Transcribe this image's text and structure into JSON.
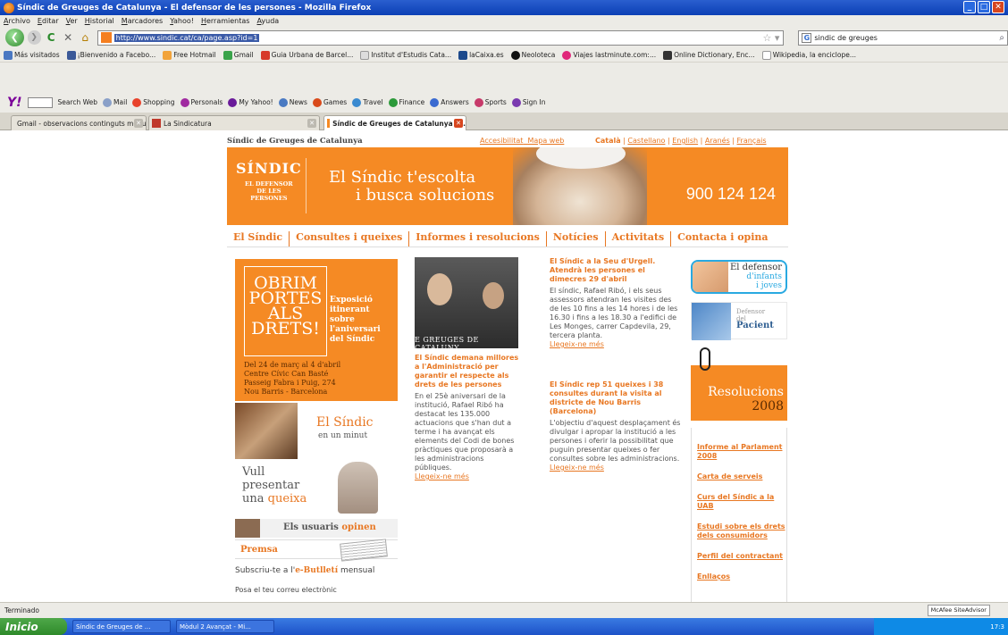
{
  "browser": {
    "window_title": "Síndic de Greuges de Catalunya - El defensor de les persones - Mozilla Firefox",
    "menu": [
      "Archivo",
      "Editar",
      "Ver",
      "Historial",
      "Marcadores",
      "Yahoo!",
      "Herramientas",
      "Ayuda"
    ],
    "url": "http://www.sindic.cat/ca/page.asp?id=1",
    "search_value": "sindic de greuges",
    "bookmarks": [
      "Más visitados",
      "¡Bienvenido a Facebo...",
      "Free Hotmail",
      "Gmail",
      "Guia Urbana de Barcel...",
      "Institut d'Estudis Cata...",
      "laCaixa.es",
      "Neoloteca",
      "Viajes lastminute.com:...",
      "Online Dictionary, Enc...",
      "Wikipedia, la enciclope..."
    ],
    "yahoo_items": [
      "Search Web",
      "Mail",
      "Shopping",
      "Personals",
      "My Yahoo!",
      "News",
      "Games",
      "Travel",
      "Finance",
      "Answers",
      "Sports",
      "Sign In"
    ],
    "tabs": [
      {
        "label": "Gmail - observacions continguts mòduls..."
      },
      {
        "label": "La Sindicatura"
      },
      {
        "label": "Síndic de Greuges de Catalunya -..."
      }
    ],
    "status": "Terminado",
    "mcafee": "McAfee SiteAdvisor",
    "taskbar": {
      "start": "Inicio",
      "items": [
        "Síndic de Greuges de ...",
        "Mòdul 2 Avançat - Mi..."
      ],
      "clock": "17:3"
    }
  },
  "page": {
    "brand": "Síndic de Greuges de Catalunya",
    "utility_links": [
      "Accesibilitat",
      "Mapa web"
    ],
    "languages": [
      "Català",
      "Castellano",
      "English",
      "Aranés",
      "Français"
    ],
    "banner": {
      "logo": "SÍNDIC",
      "logo_sub": [
        "EL DEFENSOR",
        "DE LES",
        "PERSONES"
      ],
      "tagline": [
        "El Síndic t'escolta",
        "i busca solucions"
      ],
      "phone": "900 124 124"
    },
    "nav": [
      "El Síndic",
      "Consultes i queixes",
      "Informes i resolucions",
      "Notícies",
      "Activitats",
      "Contacta i opina"
    ],
    "obrim": {
      "title": [
        "OBRIM",
        "PORTES",
        "ALS",
        "DRETS!"
      ],
      "side": [
        "Exposició",
        "itinerant",
        "sobre",
        "l'aniversari",
        "del Síndic"
      ],
      "dates": [
        "Del 24 de març al 4 d'abril",
        "Centre Cívic Can Basté",
        "Passeig Fabra i Puig, 274",
        "Nou Barris - Barcelona"
      ]
    },
    "minut": {
      "title": "El Síndic",
      "sub": "en un minut"
    },
    "vull": {
      "l1": "Vull",
      "l2": "presentar",
      "l3a": "una ",
      "l3b": "queixa"
    },
    "usuaris": {
      "a": "Els usuaris ",
      "b": "opinen"
    },
    "premsa": "Premsa",
    "subscriu": {
      "a": "Subscriu-te a l'",
      "b": "e-Butlletí",
      "c": " mensual"
    },
    "posa": "Posa el teu correu electrònic",
    "mid": {
      "photo_caption": "E GREUGES DE CATALUNY",
      "headline": "El Síndic demana millores a l'Administració per garantir el respecte als drets de les persones",
      "body": "En el 25è aniversari de la institució, Rafael Ribó ha destacat les 135.000 actuacions que s'han dut a terme i ha avançat els elements del Codi de bones pràctiques que proposarà a les administracions públiques.",
      "more": "Llegeix-ne més"
    },
    "news": [
      {
        "headline": "El Síndic a la Seu d'Urgell. Atendrà les persones el dimecres 29 d'abril",
        "body": "El síndic, Rafael Ribó, i els seus assessors atendran les visites des de les 10 fins a les 14 hores i de les 16.30 i fins a les 18.30 a l'edifici de Les Monges, carrer Capdevila, 29, tercera planta.",
        "more": "Llegeix-ne més"
      },
      {
        "headline": "El Síndic rep 51 queixes i 38 consultes durant la visita al districte de Nou Barris (Barcelona)",
        "body": "L'objectiu d'aquest desplaçament és divulgar i apropar la institució a les persones i oferir la possibilitat que puguin presentar queixes o fer consultes sobre les administracions.",
        "more": "Llegeix-ne més"
      }
    ],
    "right": {
      "infants": [
        "El defensor",
        "d'infants",
        "i joves"
      ],
      "pacient": [
        "Defensor",
        "del",
        "Pacient"
      ],
      "resolucions": "Resolucions",
      "year": "2008",
      "links": [
        "Informe al Parlament 2008",
        "Carta de serveis",
        "Curs del Síndic a la UAB",
        "Estudi sobre els drets dels consumidors",
        "Perfil del contractant",
        "Enllaços"
      ]
    }
  },
  "colors": {
    "accent": "#f58a24",
    "link": "#e87722",
    "titlebar": "#0b3fb5"
  }
}
